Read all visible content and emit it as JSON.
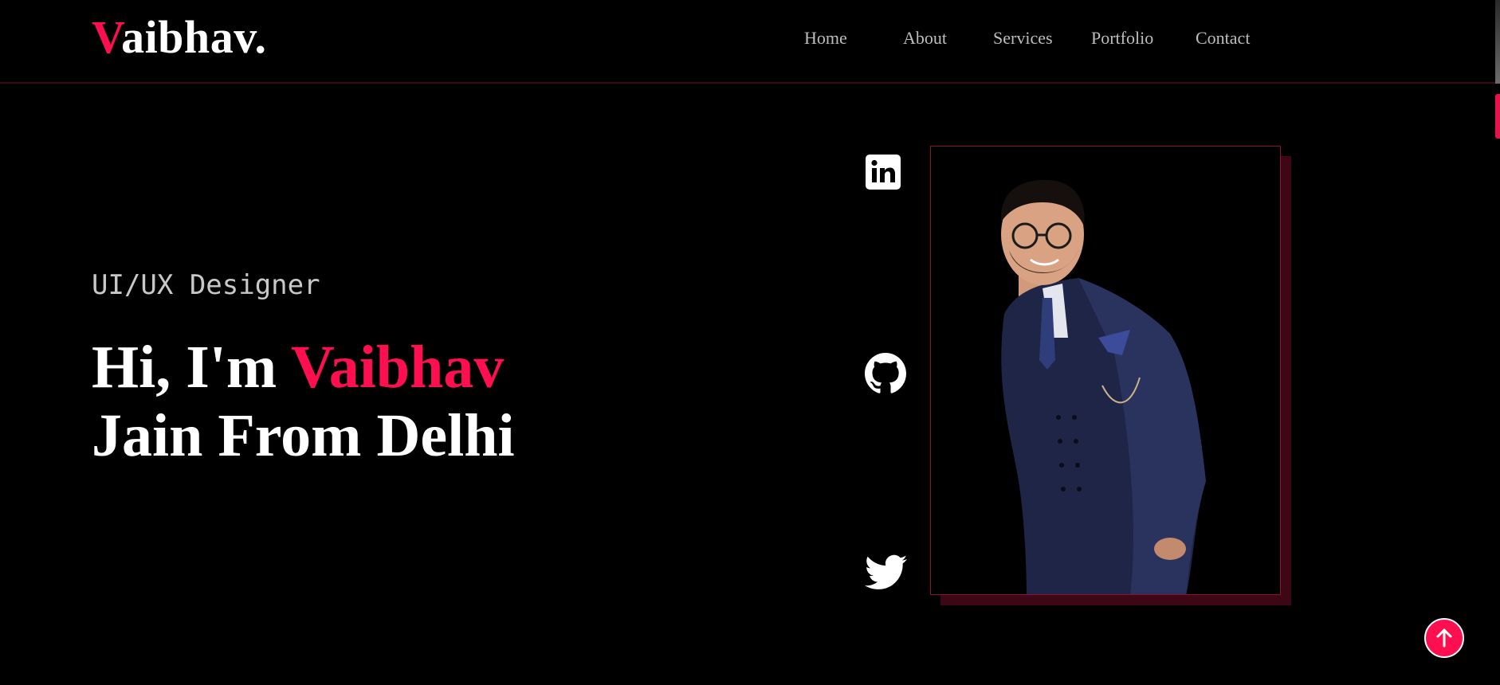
{
  "logo": {
    "first_letter": "V",
    "rest": "aibhav."
  },
  "nav": {
    "items": [
      {
        "label": "Home"
      },
      {
        "label": "About"
      },
      {
        "label": "Services"
      },
      {
        "label": "Portfolio"
      },
      {
        "label": "Contact"
      }
    ]
  },
  "hero": {
    "role": "UI/UX Designer",
    "greeting": "Hi, I'm ",
    "name": "Vaibhav",
    "line2": "Jain From Delhi"
  },
  "social": [
    {
      "icon": "linkedin-icon"
    },
    {
      "icon": "github-icon"
    },
    {
      "icon": "twitter-icon"
    }
  ],
  "colors": {
    "accent": "#ff0f50",
    "background": "#000000",
    "nav_text": "#bdbdbd",
    "text": "#ffffff",
    "frame_border": "#8a1134",
    "frame_shadow": "#3d0715"
  },
  "back_to_top": {
    "icon": "arrow-up-icon"
  }
}
